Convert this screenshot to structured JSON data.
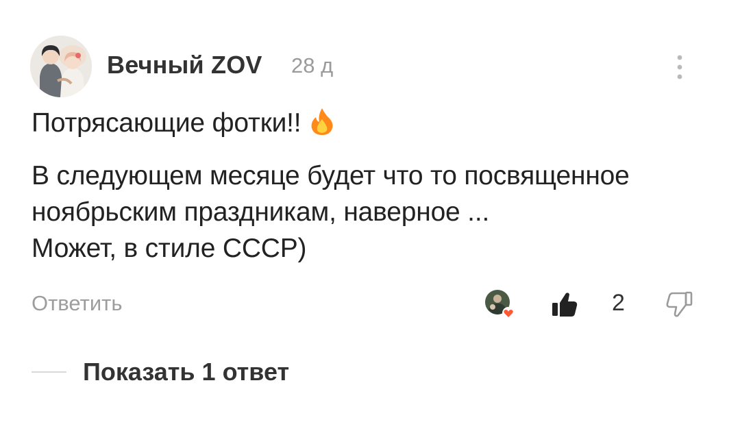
{
  "comment": {
    "author": "Вечный ZOV",
    "time": "28 д",
    "avatar_icon": "user-avatar-couple-illustration",
    "more_icon": "more-vertical-icon",
    "text_lines": [
      "Потрясающие фотки!!",
      "В следующем месяце будет что то посвященное",
      "ноябрьским праздникам, наверное ...",
      "Может, в стиле СССР)"
    ],
    "emoji": "fire-icon"
  },
  "actions": {
    "reply_label": "Ответить",
    "reaction_avatar_icon": "reactor-avatar-with-heart-icon",
    "like_icon": "thumbs-up-filled-icon",
    "like_count": "2",
    "dislike_icon": "thumbs-down-outline-icon"
  },
  "replies": {
    "show_label": "Показать 1 ответ"
  },
  "colors": {
    "text": "#222222",
    "muted": "#9d9d9d",
    "heart": "#ff5a36",
    "fire_outer": "#ff8a1a",
    "fire_inner": "#ffd23f"
  }
}
